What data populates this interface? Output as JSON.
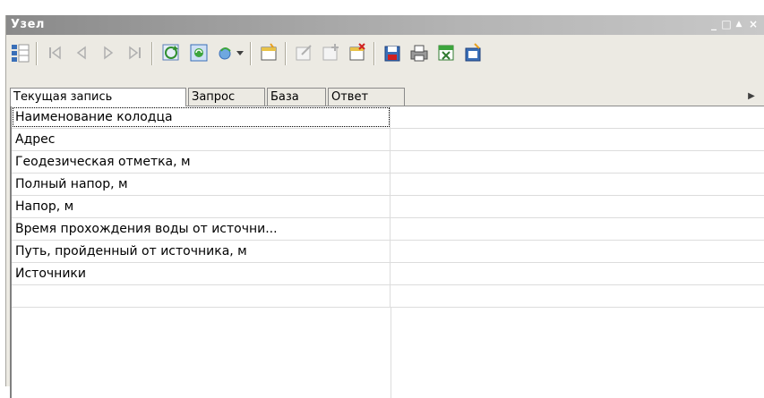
{
  "window": {
    "title": "Узел"
  },
  "tabs": [
    {
      "label": "Текущая запись",
      "active": true
    },
    {
      "label": "Запрос",
      "active": false
    },
    {
      "label": "База",
      "active": false
    },
    {
      "label": "Ответ",
      "active": false
    }
  ],
  "rows": [
    {
      "name": "Наименование колодца",
      "value": ""
    },
    {
      "name": "Адрес",
      "value": ""
    },
    {
      "name": "Геодезическая отметка, м",
      "value": ""
    },
    {
      "name": "Полный напор, м",
      "value": ""
    },
    {
      "name": "Напор, м",
      "value": ""
    },
    {
      "name": "Время прохождения воды от источни...",
      "value": ""
    },
    {
      "name": "Путь, пройденный от источника, м",
      "value": ""
    },
    {
      "name": "Источники",
      "value": ""
    },
    {
      "name": "",
      "value": ""
    }
  ]
}
